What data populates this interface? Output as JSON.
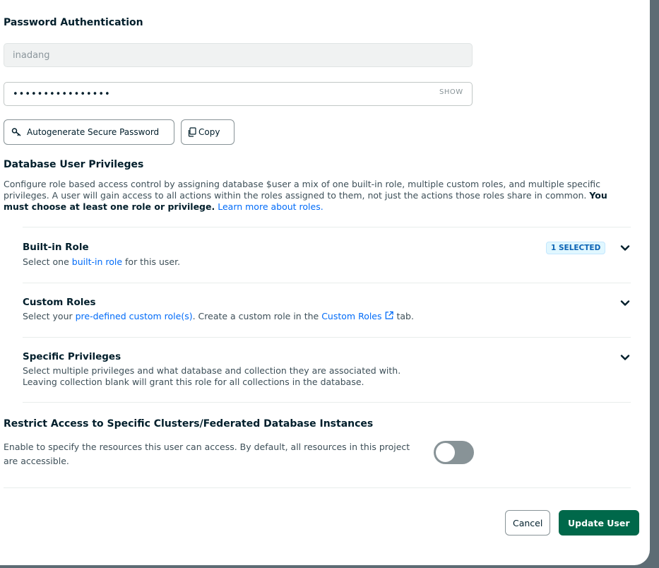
{
  "password_auth": {
    "heading": "Password Authentication",
    "username_value": "inadang",
    "password_value": "••••••••••••••••",
    "show_label": "SHOW",
    "autogen_label": "Autogenerate Secure Password",
    "copy_label": "Copy"
  },
  "privileges": {
    "heading": "Database User Privileges",
    "description_1": "Configure role based access control by assigning database $user a mix of one built-in role, multiple custom roles, and multiple specific privileges. A user will gain access to all actions within the roles assigned to them, not just the actions those roles share in common.",
    "description_bold": "You must choose at least one role or privilege.",
    "learn_more": "Learn more about roles.",
    "sections": [
      {
        "title": "Built-in Role",
        "sub_pre": "Select one ",
        "sub_link": "built-in role",
        "sub_post": " for this user.",
        "badge": "1 SELECTED"
      },
      {
        "title": "Custom Roles",
        "sub_pre": "Select your ",
        "sub_link": "pre-defined custom role(s)",
        "sub_mid": ". Create a custom role in the ",
        "sub_link2": "Custom Roles",
        "sub_post": " tab."
      },
      {
        "title": "Specific Privileges",
        "sub_line1": "Select multiple privileges and what database and collection they are associated with.",
        "sub_line2": "Leaving collection blank will grant this role for all collections in the database."
      }
    ]
  },
  "restrict": {
    "heading": "Restrict Access to Specific Clusters/Federated Database Instances",
    "desc_line1": "Enable to specify the resources this user can access. By default, all resources in this project",
    "desc_line2": "are accessible."
  },
  "footer": {
    "cancel_label": "Cancel",
    "update_label": "Update User"
  }
}
